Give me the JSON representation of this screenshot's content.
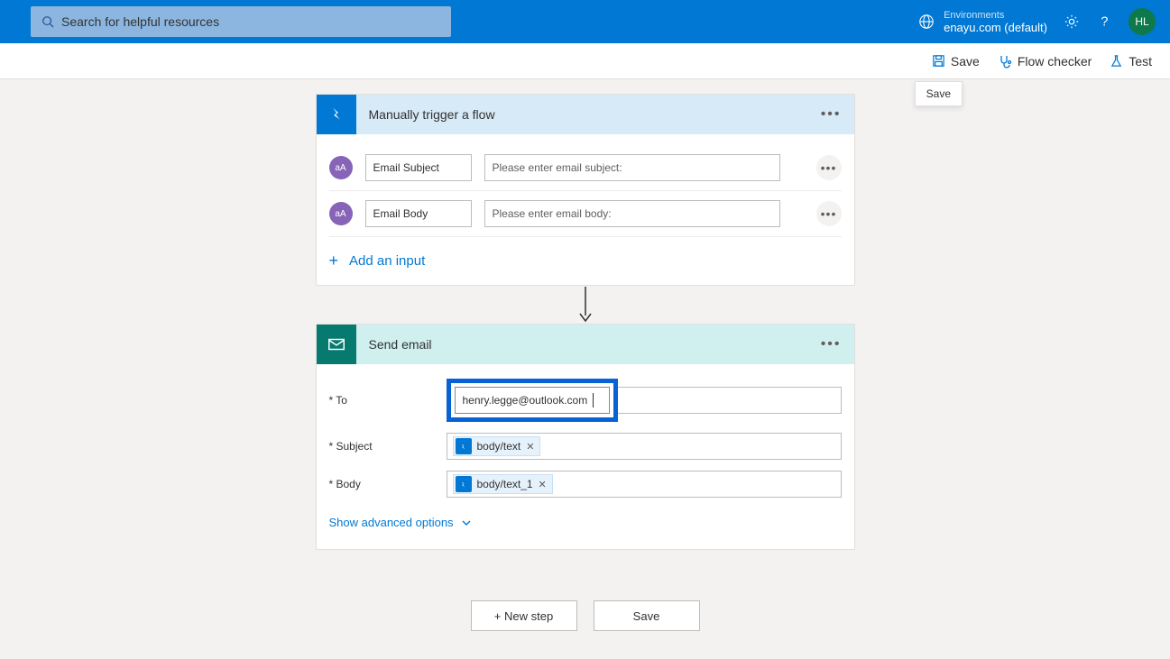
{
  "header": {
    "search_placeholder": "Search for helpful resources",
    "env_label": "Environments",
    "env_value": "enayu.com (default)",
    "avatar_initials": "HL"
  },
  "cmd": {
    "save": "Save",
    "flow_checker": "Flow checker",
    "test": "Test",
    "tooltip": "Save"
  },
  "trigger_card": {
    "title": "Manually trigger a flow",
    "inputs": [
      {
        "name": "Email Subject",
        "placeholder": "Please enter email subject:"
      },
      {
        "name": "Email Body",
        "placeholder": "Please enter email body:"
      }
    ],
    "add_input": "Add an input"
  },
  "action_card": {
    "title": "Send email",
    "fields": {
      "to_label": "* To",
      "to_value": "henry.legge@outlook.com",
      "subject_label": "* Subject",
      "subject_token": "body/text",
      "body_label": "* Body",
      "body_token": "body/text_1"
    },
    "advanced": "Show advanced options"
  },
  "buttons": {
    "new_step": "+ New step",
    "save": "Save"
  }
}
